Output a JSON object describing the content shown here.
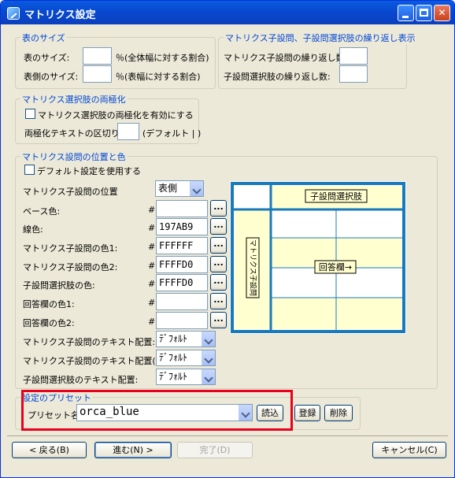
{
  "window": {
    "title": "マトリクス設定"
  },
  "table_size": {
    "legend": "表のサイズ",
    "size_label": "表のサイズ:",
    "size_value": "",
    "size_unit": "％(全体幅に対する割合)",
    "side_label": "表側のサイズ:",
    "side_value": "",
    "side_unit": "％(表幅に対する割合)"
  },
  "repeat": {
    "legend": "マトリクス子設問、子設問選択肢の繰り返し表示",
    "child_label": "マトリクス子設問の繰り返し数:",
    "child_value": "",
    "choice_label": "子設問選択肢の繰り返し数:",
    "choice_value": ""
  },
  "polar": {
    "legend": "マトリクス選択肢の両極化",
    "enable_label": "マトリクス選択肢の両極化を有効にする",
    "enable_checked": false,
    "separator_label": "両極化テキストの区切り:",
    "separator_value": "",
    "separator_hint": "(デフォルト | )"
  },
  "position": {
    "legend": "マトリクス設問の位置と色",
    "default_label": "デフォルト設定を使用する",
    "default_checked": false,
    "pos_label": "マトリクス子設問の位置",
    "pos_value": "表側",
    "hash": "#",
    "browse": "...",
    "colors": [
      {
        "label": "ベース色:",
        "value": ""
      },
      {
        "label": "線色:",
        "value": "197AB9"
      },
      {
        "label": "マトリクス子設問の色1:",
        "value": "FFFFFF"
      },
      {
        "label": "マトリクス子設問の色2:",
        "value": "FFFFD0"
      },
      {
        "label": "子設問選択肢の色:",
        "value": "FFFFD0"
      },
      {
        "label": "回答欄の色1:",
        "value": ""
      },
      {
        "label": "回答欄の色2:",
        "value": ""
      }
    ],
    "aligns": [
      {
        "label": "マトリクス子設問のテキスト配置:",
        "value": "ﾃﾞﾌｫﾙﾄ"
      },
      {
        "label": "マトリクス子設問のテキスト配置(右):",
        "value": "ﾃﾞﾌｫﾙﾄ"
      },
      {
        "label": "子設問選択肢のテキスト配置:",
        "value": "ﾃﾞﾌｫﾙﾄ"
      }
    ]
  },
  "preview": {
    "choice_label": "子設問選択肢",
    "child_label": "マトリクス子設問",
    "answer_label": "回答欄→",
    "line_color": "#197AB9",
    "fill_color": "#FFFFD0",
    "alt_color": "#FFFFFF"
  },
  "preset": {
    "legend": "設定のプリセット",
    "label": "プリセット名:",
    "value": "orca_blue",
    "load": "読込",
    "register": "登録",
    "delete": "削除"
  },
  "footer": {
    "back": "< 戻る(B)",
    "next": "進む(N) >",
    "finish": "完了(D)",
    "cancel": "キャンセル(C)"
  },
  "highlight_color": "#E8001C"
}
